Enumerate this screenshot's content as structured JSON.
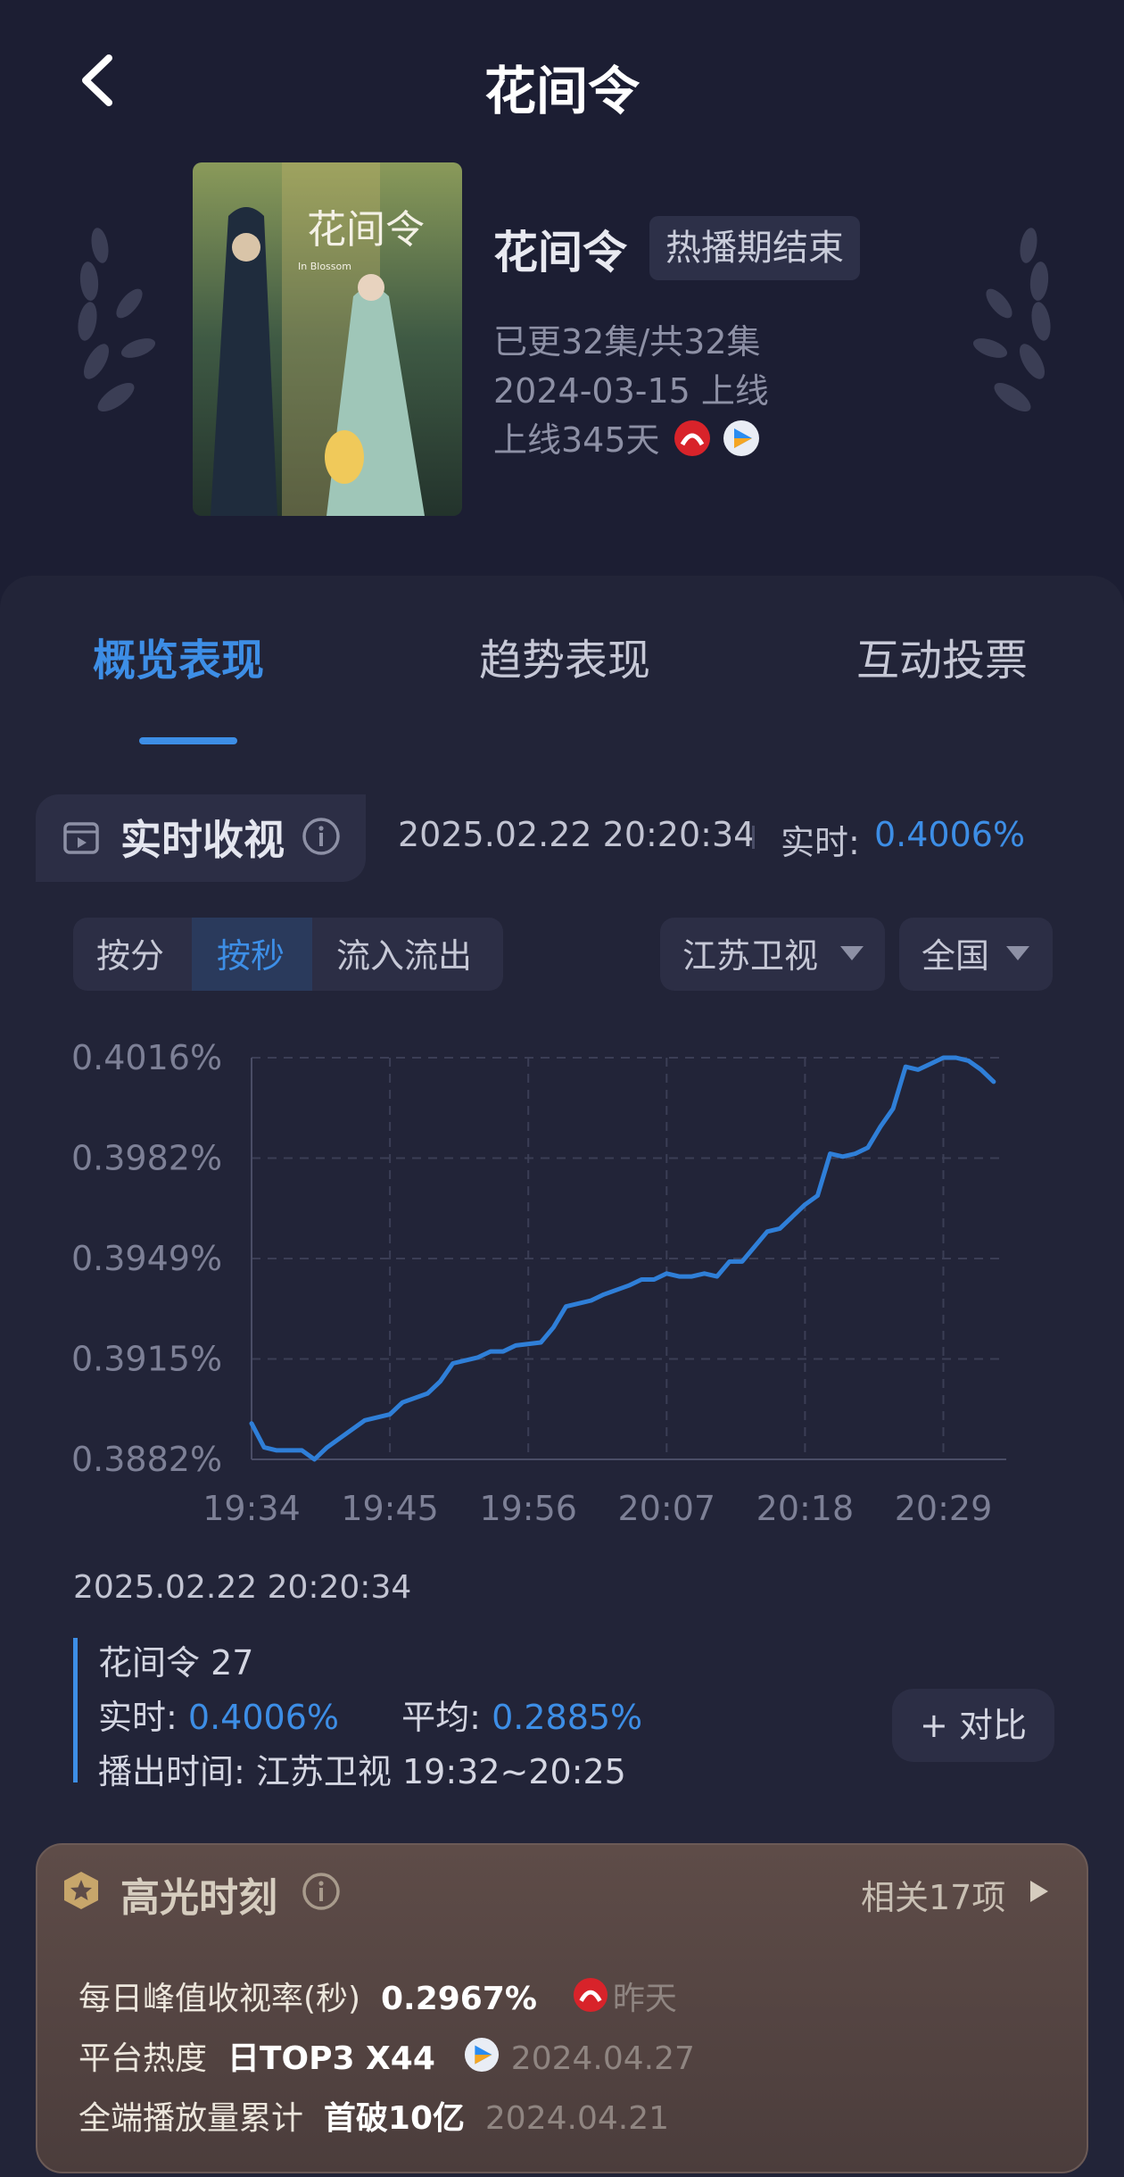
{
  "header": {
    "title": "花间令"
  },
  "show": {
    "name": "花间令",
    "status": "热播期结束",
    "episodes": "已更32集/共32集",
    "launch": "2024-03-15 上线",
    "days_online": "上线345天",
    "poster_title": "花间令",
    "poster_subtitle": "In Blossom"
  },
  "tabs": [
    {
      "label": "概览表现",
      "active": true
    },
    {
      "label": "趋势表现",
      "active": false
    },
    {
      "label": "互动投票",
      "active": false
    }
  ],
  "realtime": {
    "title": "实时收视",
    "timestamp": "2025.02.22 20:20:34",
    "value_label": "实时:",
    "value": "0.4006%"
  },
  "controls": {
    "segments": [
      "按分",
      "按秒",
      "流入流出"
    ],
    "active_segment": "按秒",
    "channel": "江苏卫视",
    "region": "全国"
  },
  "chart_data": {
    "type": "line",
    "x_ticks": [
      "19:34",
      "19:45",
      "19:56",
      "20:07",
      "20:18",
      "20:29"
    ],
    "y_ticks": [
      "0.4016%",
      "0.3982%",
      "0.3949%",
      "0.3915%",
      "0.3882%"
    ],
    "ylim": [
      0.3882,
      0.4016
    ],
    "x_range_minutes": [
      "19:34",
      "20:34"
    ],
    "grid": true,
    "series": [
      {
        "color": "#2f7fd8",
        "points": [
          [
            "19:34",
            0.3894
          ],
          [
            "19:35",
            0.3886
          ],
          [
            "19:36",
            0.3885
          ],
          [
            "19:38",
            0.3885
          ],
          [
            "19:39",
            0.3882
          ],
          [
            "19:40",
            0.3886
          ],
          [
            "19:41",
            0.3889
          ],
          [
            "19:43",
            0.3895
          ],
          [
            "19:45",
            0.3897
          ],
          [
            "19:46",
            0.3901
          ],
          [
            "19:48",
            0.3904
          ],
          [
            "19:49",
            0.3908
          ],
          [
            "19:50",
            0.3914
          ],
          [
            "19:52",
            0.3916
          ],
          [
            "19:53",
            0.3918
          ],
          [
            "19:54",
            0.3918
          ],
          [
            "19:55",
            0.392
          ],
          [
            "19:57",
            0.3921
          ],
          [
            "19:58",
            0.3926
          ],
          [
            "19:59",
            0.3933
          ],
          [
            "20:01",
            0.3935
          ],
          [
            "20:02",
            0.3937
          ],
          [
            "20:04",
            0.394
          ],
          [
            "20:05",
            0.3942
          ],
          [
            "20:06",
            0.3942
          ],
          [
            "20:07",
            0.3944
          ],
          [
            "20:08",
            0.3943
          ],
          [
            "20:09",
            0.3943
          ],
          [
            "20:10",
            0.3944
          ],
          [
            "20:11",
            0.3943
          ],
          [
            "20:12",
            0.3948
          ],
          [
            "20:13",
            0.3948
          ],
          [
            "20:14",
            0.3953
          ],
          [
            "20:15",
            0.3958
          ],
          [
            "20:16",
            0.3959
          ],
          [
            "20:17",
            0.3963
          ],
          [
            "20:18",
            0.3967
          ],
          [
            "20:19",
            0.397
          ],
          [
            "20:20",
            0.3984
          ],
          [
            "20:21",
            0.3983
          ],
          [
            "20:22",
            0.3984
          ],
          [
            "20:23",
            0.3986
          ],
          [
            "20:24",
            0.3993
          ],
          [
            "20:25",
            0.3999
          ],
          [
            "20:26",
            0.4013
          ],
          [
            "20:27",
            0.4012
          ],
          [
            "20:28",
            0.4014
          ],
          [
            "20:29",
            0.4016
          ],
          [
            "20:30",
            0.4016
          ],
          [
            "20:31",
            0.4015
          ],
          [
            "20:32",
            0.4012
          ],
          [
            "20:33",
            0.4008
          ]
        ]
      }
    ]
  },
  "detail": {
    "timestamp": "2025.02.22 20:20:34",
    "episode": "花间令 27",
    "realtime_label": "实时:",
    "realtime_value": "0.4006%",
    "average_label": "平均:",
    "average_value": "0.2885%",
    "airtime_label": "播出时间:",
    "airtime_value": "江苏卫视 19:32~20:25",
    "compare_label": "+ 对比"
  },
  "highlights": {
    "title": "高光时刻",
    "related": "相关17项",
    "rows": [
      {
        "label": "每日峰值收视率(秒)",
        "value": "0.2967%",
        "note": "昨天",
        "icon": "red-platform-icon"
      },
      {
        "label": "平台热度",
        "value": "日TOP3 X44",
        "note": "2024.04.27",
        "icon": "blue-platform-icon"
      },
      {
        "label": "全端播放量累计",
        "value": "首破10亿",
        "note": "2024.04.21",
        "icon": ""
      }
    ]
  },
  "colors": {
    "accent": "#3d8ee6",
    "bg": "#1c1e33",
    "panel": "#222438"
  }
}
